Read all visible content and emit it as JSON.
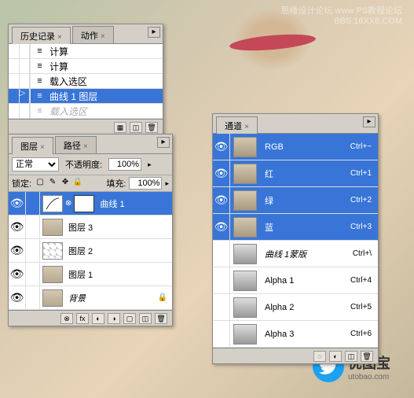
{
  "watermark": {
    "line1": "思缘设计论坛 www PS教程论坛",
    "line2": "BBS.16XX8.COM"
  },
  "logo": {
    "brand": "优图宝",
    "url": "utobao.com"
  },
  "history": {
    "tabs": [
      "历史记录",
      "动作"
    ],
    "items": [
      {
        "label": "计算",
        "icon": "≡"
      },
      {
        "label": "计算",
        "icon": "≡"
      },
      {
        "label": "载入选区",
        "icon": "≡"
      },
      {
        "label": "曲线 1 图层",
        "icon": "≡",
        "selected": true,
        "pointer": true
      },
      {
        "label": "载入选区",
        "icon": "≡",
        "dimmed": true
      }
    ]
  },
  "layers": {
    "tabs": [
      "图层",
      "路径"
    ],
    "blend_label": "正常",
    "opacity_label": "不透明度:",
    "opacity_value": "100%",
    "lock_label": "锁定:",
    "fill_label": "填充:",
    "fill_value": "100%",
    "items": [
      {
        "name": "曲线 1",
        "selected": true,
        "type": "adjustment"
      },
      {
        "name": "图层 3",
        "type": "photo"
      },
      {
        "name": "图层 2",
        "type": "transparent"
      },
      {
        "name": "图层 1",
        "type": "photo"
      },
      {
        "name": "背景",
        "type": "photo",
        "italic": true
      }
    ]
  },
  "channels": {
    "tab": "通道",
    "items": [
      {
        "name": "RGB",
        "shortcut": "Ctrl+~",
        "selected": true,
        "thumb": "rgb"
      },
      {
        "name": "红",
        "shortcut": "Ctrl+1",
        "selected": true,
        "thumb": "rgb"
      },
      {
        "name": "绿",
        "shortcut": "Ctrl+2",
        "selected": true,
        "thumb": "rgb"
      },
      {
        "name": "蓝",
        "shortcut": "Ctrl+3",
        "selected": true,
        "thumb": "rgb"
      },
      {
        "name": "曲线 1蒙版",
        "shortcut": "Ctrl+\\",
        "thumb": "gray"
      },
      {
        "name": "Alpha 1",
        "shortcut": "Ctrl+4",
        "thumb": "gray"
      },
      {
        "name": "Alpha 2",
        "shortcut": "Ctrl+5",
        "thumb": "gray"
      },
      {
        "name": "Alpha 3",
        "shortcut": "Ctrl+6",
        "thumb": "gray"
      }
    ]
  }
}
